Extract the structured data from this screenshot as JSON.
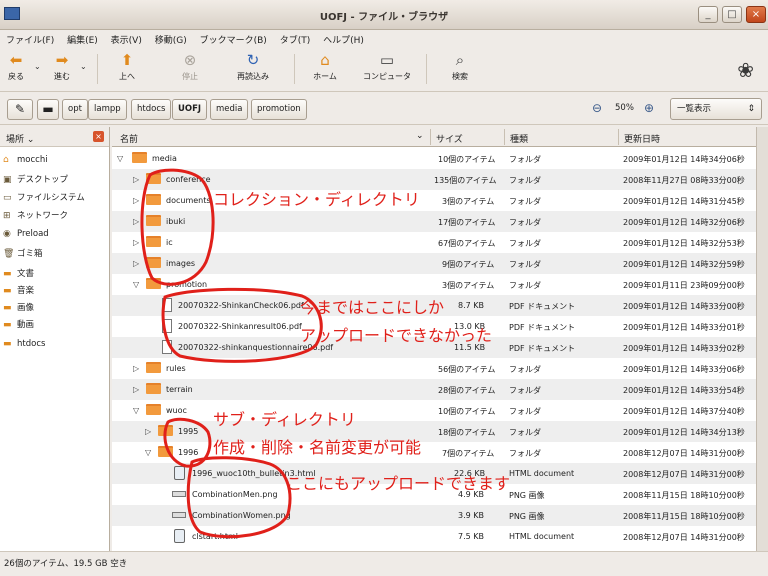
{
  "window": {
    "title": "UOFJ - ファイル・ブラウザ",
    "btn_min": "_",
    "btn_max": "□",
    "btn_close": "×"
  },
  "menu": [
    "ファイル(F)",
    "編集(E)",
    "表示(V)",
    "移動(G)",
    "ブックマーク(B)",
    "タブ(T)",
    "ヘルプ(H)"
  ],
  "toolbar": {
    "back": "戻る",
    "forward": "進む",
    "up": "上へ",
    "stop": "停止",
    "reload": "再読込み",
    "home": "ホーム",
    "computer": "コンピュータ",
    "search": "検索"
  },
  "path": [
    "opt",
    "lampp",
    "htdocs",
    "UOFJ",
    "media",
    "promotion"
  ],
  "zoom": "50%",
  "view_mode": "一覧表示",
  "sidebar": {
    "header": "場所",
    "items": [
      "mocchi",
      "デスクトップ",
      "ファイルシステム",
      "ネットワーク",
      "Preload",
      "ゴミ箱",
      "文書",
      "音楽",
      "画像",
      "動画",
      "htdocs"
    ]
  },
  "columns": {
    "name": "名前",
    "size": "サイズ",
    "type": "種類",
    "date": "更新日時"
  },
  "rows": [
    {
      "name": "media",
      "size": "10個のアイテム",
      "type": "フォルダ",
      "date": "2009年01月12日 14時34分06秒"
    },
    {
      "name": "conference",
      "size": "135個のアイテム",
      "type": "フォルダ",
      "date": "2008年11月27日 08時33分00秒"
    },
    {
      "name": "documents",
      "size": "3個のアイテム",
      "type": "フォルダ",
      "date": "2009年01月12日 14時31分45秒"
    },
    {
      "name": "ibuki",
      "size": "17個のアイテム",
      "type": "フォルダ",
      "date": "2009年01月12日 14時32分06秒"
    },
    {
      "name": "ic",
      "size": "67個のアイテム",
      "type": "フォルダ",
      "date": "2009年01月12日 14時32分53秒"
    },
    {
      "name": "images",
      "size": "9個のアイテム",
      "type": "フォルダ",
      "date": "2009年01月12日 14時32分59秒"
    },
    {
      "name": "promotion",
      "size": "3個のアイテム",
      "type": "フォルダ",
      "date": "2009年01月11日 23時09分00秒"
    },
    {
      "name": "20070322-ShinkanCheck06.pdf",
      "size": "8.7 KB",
      "type": "PDF ドキュメント",
      "date": "2009年01月12日 14時33分00秒"
    },
    {
      "name": "20070322-Shinkanresult06.pdf",
      "size": "13.0 KB",
      "type": "PDF ドキュメント",
      "date": "2009年01月12日 14時33分01秒"
    },
    {
      "name": "20070322-shinkanquestionnaire06.pdf",
      "size": "11.5 KB",
      "type": "PDF ドキュメント",
      "date": "2009年01月12日 14時33分02秒"
    },
    {
      "name": "rules",
      "size": "56個のアイテム",
      "type": "フォルダ",
      "date": "2009年01月12日 14時33分06秒"
    },
    {
      "name": "terrain",
      "size": "28個のアイテム",
      "type": "フォルダ",
      "date": "2009年01月12日 14時33分54秒"
    },
    {
      "name": "wuoc",
      "size": "10個のアイテム",
      "type": "フォルダ",
      "date": "2009年01月12日 14時37分40秒"
    },
    {
      "name": "1995",
      "size": "18個のアイテム",
      "type": "フォルダ",
      "date": "2009年01月12日 14時34分13秒"
    },
    {
      "name": "1996",
      "size": "7個のアイテム",
      "type": "フォルダ",
      "date": "2008年12月07日 14時31分00秒"
    },
    {
      "name": "1996_wuoc10th_bulletin3.html",
      "size": "22.6 KB",
      "type": "HTML document",
      "date": "2008年12月07日 14時31分00秒"
    },
    {
      "name": "CombinationMen.png",
      "size": "4.9 KB",
      "type": "PNG 画像",
      "date": "2008年11月15日 18時10分00秒"
    },
    {
      "name": "CombinationWomen.png",
      "size": "3.9 KB",
      "type": "PNG 画像",
      "date": "2008年11月15日 18時10分00秒"
    },
    {
      "name": "clstart.html",
      "size": "7.5 KB",
      "type": "HTML document",
      "date": "2008年12月07日 14時31分00秒"
    }
  ],
  "status": "26個のアイテム、19.5 GB 空き",
  "annotations": {
    "collection": "コレクション・ディレクトリ",
    "upload_only_1": "今まではここにしか",
    "upload_only_2": "アップロードできなかった",
    "sub_1": "サブ・ディレクトリ",
    "sub_2": "作成・削除・名前変更が可能",
    "upload_here": "ここにもアップロードできます"
  },
  "colors": {
    "annotation": "#e0201a",
    "folder": "#f29a3d",
    "close_button": "#d7542c"
  }
}
